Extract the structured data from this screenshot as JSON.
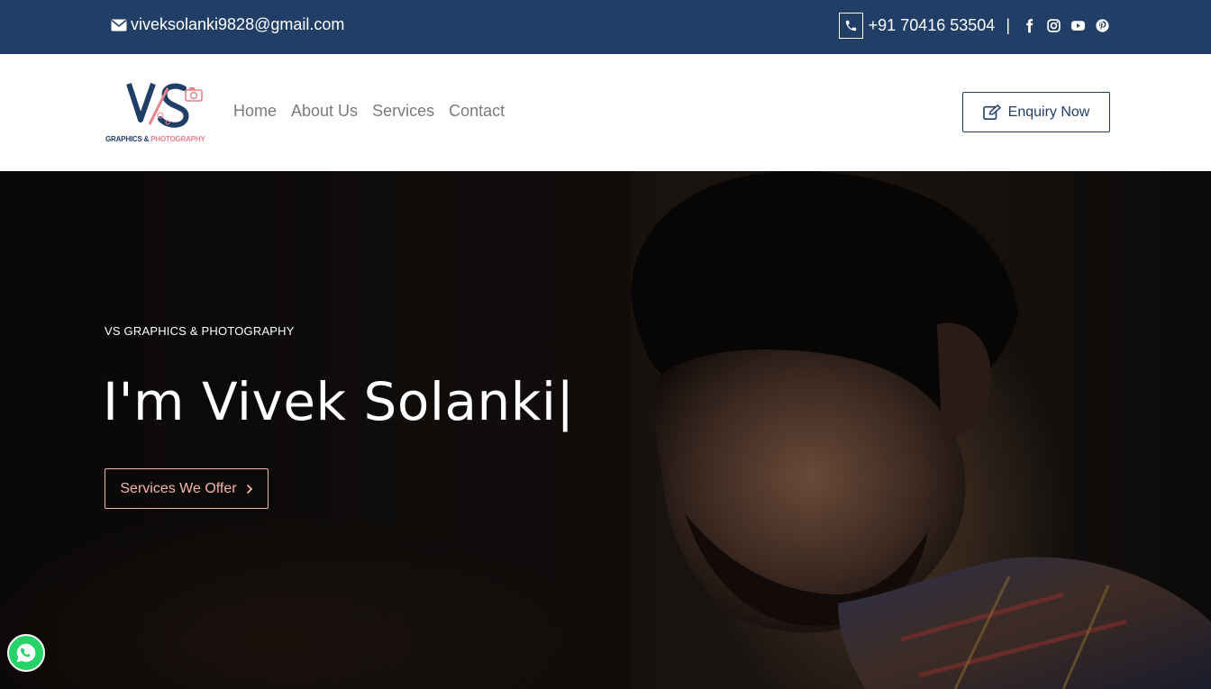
{
  "topbar": {
    "email": "viveksolanki9828@gmail.com",
    "phone": "+91 70416 53504",
    "separator": "|",
    "social_icons": [
      "facebook-icon",
      "instagram-icon",
      "youtube-icon",
      "pinterest-icon"
    ]
  },
  "header": {
    "logo": {
      "text_left": "GRAPHICS & ",
      "text_right": "PHOTOGRAPHY"
    },
    "nav": [
      {
        "label": "Home"
      },
      {
        "label": "About Us"
      },
      {
        "label": "Services"
      },
      {
        "label": "Contact"
      }
    ],
    "enquiry_label": "Enquiry Now"
  },
  "hero": {
    "tagline": "VS GRAPHICS & PHOTOGRAPHY",
    "title": "I'm Vivek Solanki|",
    "button_label": "Services We Offer"
  },
  "colors": {
    "topbar_bg": "#213f66",
    "accent": "#f3b8a8",
    "logo_pink": "#e8828a",
    "whatsapp": "#25d366"
  }
}
